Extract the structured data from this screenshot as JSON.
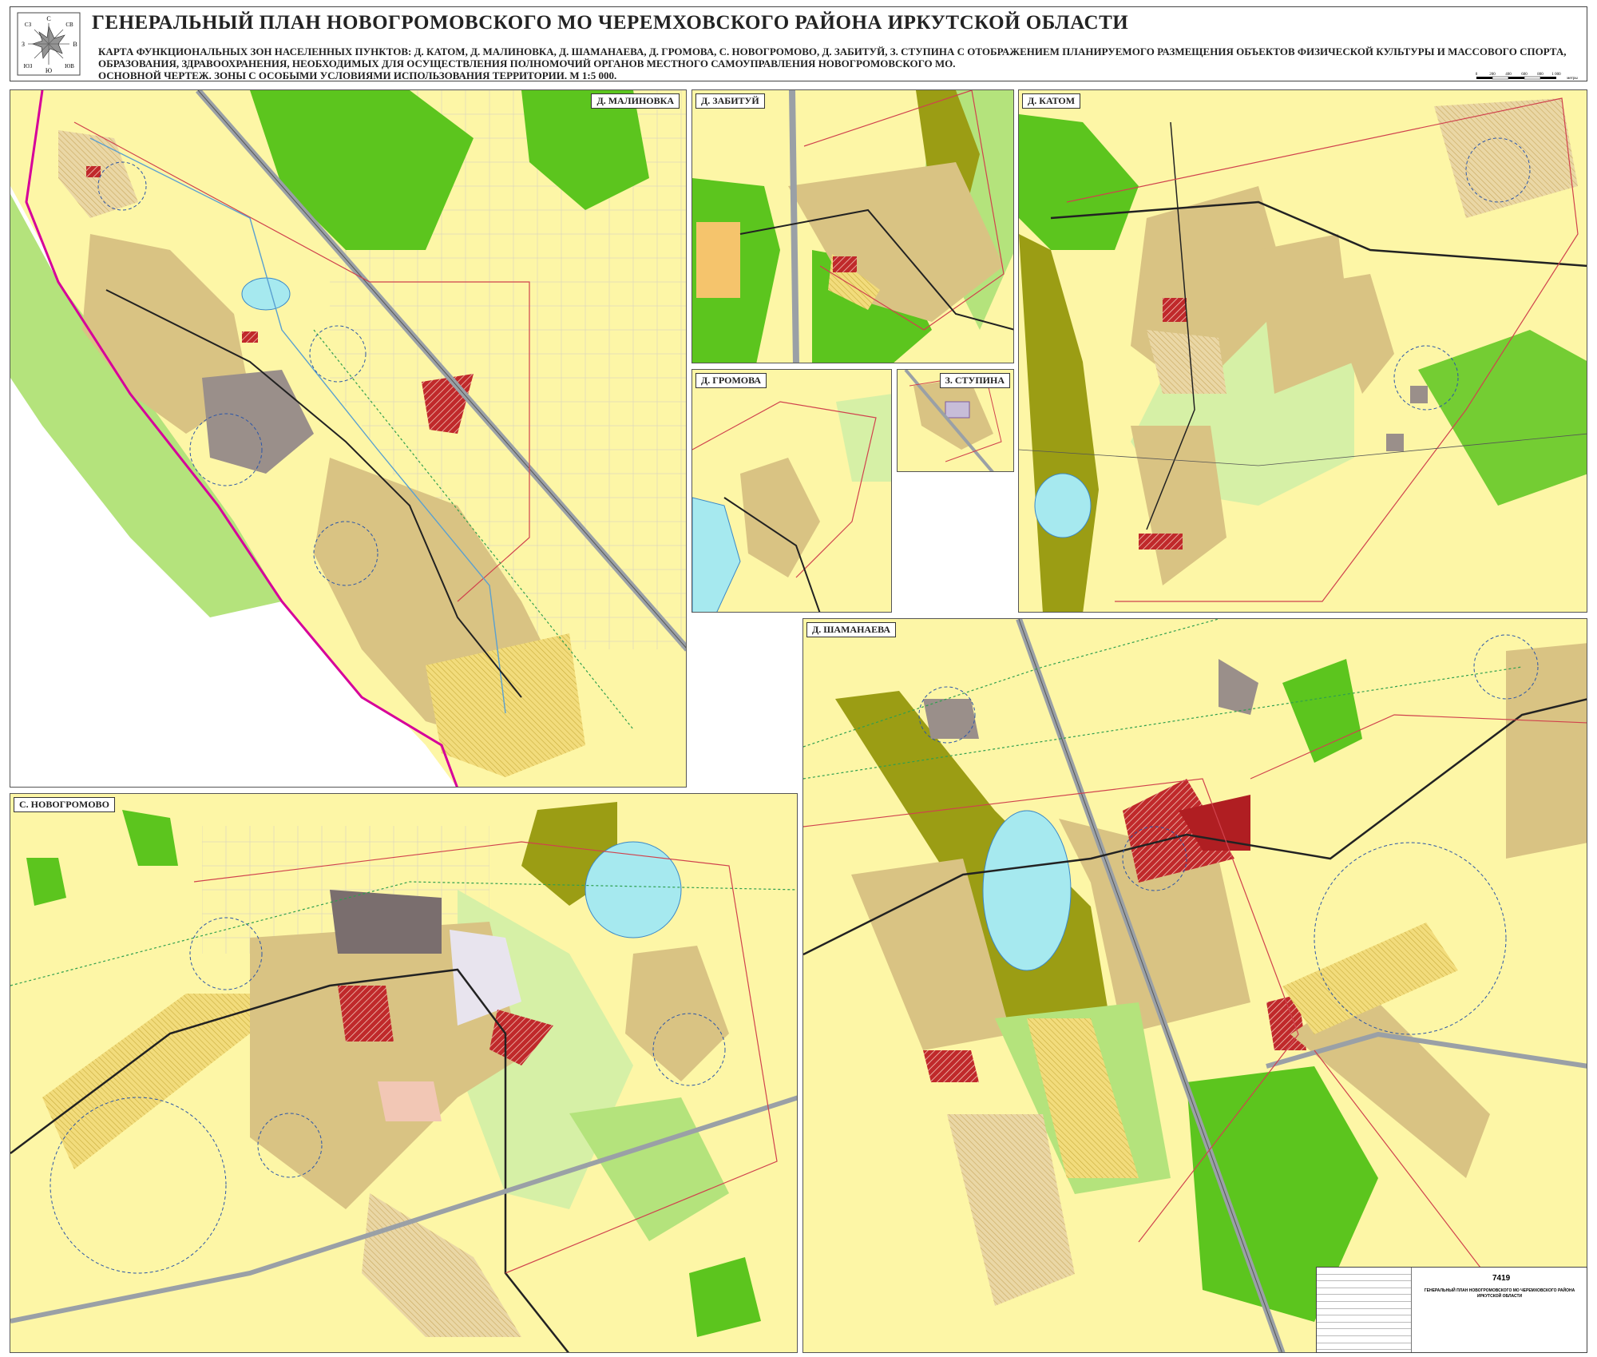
{
  "header": {
    "title": "ГЕНЕРАЛЬНЫЙ ПЛАН НОВОГРОМОВСКОГО МО ЧЕРЕМХОВСКОГО РАЙОНА ИРКУТСКОЙ ОБЛАСТИ",
    "subtitle_line1": "КАРТА  ФУНКЦИОНАЛЬНЫХ ЗОН НАСЕЛЕННЫХ ПУНКТОВ: Д. КАТОМ, Д. МАЛИНОВКА, Д. ШАМАНАЕВА, Д. ГРОМОВА, С. НОВОГРОМОВО, Д. ЗАБИТУЙ, З. СТУПИНА С ОТОБРАЖЕНИЕМ ПЛАНИРУЕМОГО РАЗМЕЩЕНИЯ ОБЪЕКТОВ ФИЗИЧЕСКОЙ КУЛЬТУРЫ И МАССОВОГО СПОРТА,",
    "subtitle_line2": "ОБРАЗОВАНИЯ, ЗДРАВООХРАНЕНИЯ, НЕОБХОДИМЫХ ДЛЯ ОСУЩЕСТВЛЕНИЯ ПОЛНОМОЧИЙ ОРГАНОВ МЕСТНОГО САМОУПРАВЛЕНИЯ НОВОГРОМОВСКОГО МО.",
    "subtitle_line3": "ОСНОВНОЙ ЧЕРТЕЖ. ЗОНЫ С ОСОБЫМИ УСЛОВИЯМИ ИСПОЛЬЗОВАНИЯ ТЕРРИТОРИИ.     М 1:5 000."
  },
  "compass": {
    "n": "С",
    "s": "Ю",
    "e": "В",
    "w": "З",
    "ne": "СВ",
    "nw": "СЗ",
    "se": "ЮВ",
    "sw": "ЮЗ"
  },
  "scale": {
    "ticks": [
      "0",
      "200",
      "400",
      "600",
      "800",
      "1 000"
    ],
    "unit": "метры"
  },
  "panels": {
    "malinovka": "Д. МАЛИНОВКА",
    "zabituy": "Д. ЗАБИТУЙ",
    "katom": "Д. КАТОМ",
    "gromova": "Д. ГРОМОВА",
    "stupina": "З. СТУПИНА",
    "novogromovo": "С. НОВОГРОМОВО",
    "shamanaeva": "Д. ШАМАНАЕВА"
  },
  "titleblock": {
    "number": "7419",
    "name": "ГЕНЕРАЛЬНЫЙ ПЛАН НОВОГРОМОВСКОГО МО ЧЕРЕМХОВСКОГО РАЙОНА ИРКУТСКОЙ ОБЛАСТИ"
  },
  "colors": {
    "background": "#fdf6a6",
    "residential": "#d9c383",
    "forest": "#5cc51e",
    "green": "#b4e37c",
    "water": "#a6e9ef",
    "public": "#9a8f8a",
    "olive": "#9b9d14",
    "hatched_red": "#c0292b",
    "boundary": "#d0424d",
    "road": "#9aa0a6"
  }
}
